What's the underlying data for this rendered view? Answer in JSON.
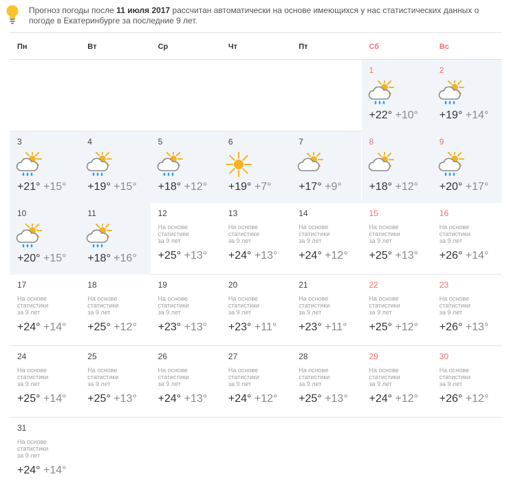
{
  "notice": {
    "text_before": "Прогноз погоды после ",
    "date_bold": "11 июля 2017",
    "text_after": " рассчитан автоматически на основе имеющихся у нас статистических данных о погоде в Екатеринбурге за последние 9 лет."
  },
  "weekdays": [
    "Пн",
    "Вт",
    "Ср",
    "Чт",
    "Пт",
    "Сб",
    "Вс"
  ],
  "stat_label_1": "На основе статистики",
  "stat_label_2": "за 9 лет",
  "colors": {
    "weekend": "#f07070",
    "past_bg": "#f1f5f9",
    "sun": "#f5b324",
    "rain": "#3ba0e0"
  },
  "weeks": [
    [
      null,
      null,
      null,
      null,
      null,
      {
        "day": "1",
        "max": "+22°",
        "min": "+10°",
        "icon": "cloud-sun-rain-icon",
        "past": true
      },
      {
        "day": "2",
        "max": "+19°",
        "min": "+14°",
        "icon": "cloud-sun-rain-icon",
        "past": true
      }
    ],
    [
      {
        "day": "3",
        "max": "+21°",
        "min": "+15°",
        "icon": "cloud-sun-rain-icon",
        "past": true
      },
      {
        "day": "4",
        "max": "+19°",
        "min": "+15°",
        "icon": "cloud-sun-rain-icon",
        "past": true
      },
      {
        "day": "5",
        "max": "+18°",
        "min": "+12°",
        "icon": "cloud-sun-rain-icon",
        "past": true
      },
      {
        "day": "6",
        "max": "+19°",
        "min": "+7°",
        "icon": "sun-icon",
        "past": true
      },
      {
        "day": "7",
        "max": "+17°",
        "min": "+9°",
        "icon": "cloud-sun-icon",
        "past": true
      },
      {
        "day": "8",
        "max": "+18°",
        "min": "+12°",
        "icon": "cloud-sun-icon",
        "past": true
      },
      {
        "day": "9",
        "max": "+20°",
        "min": "+17°",
        "icon": "cloud-sun-rain-icon",
        "past": true
      }
    ],
    [
      {
        "day": "10",
        "max": "+20°",
        "min": "+15°",
        "icon": "cloud-sun-rain-icon",
        "past": true
      },
      {
        "day": "11",
        "max": "+18°",
        "min": "+16°",
        "icon": "cloud-sun-rain-icon",
        "past": true
      },
      {
        "day": "12",
        "max": "+25°",
        "min": "+13°",
        "stat": true
      },
      {
        "day": "13",
        "max": "+24°",
        "min": "+13°",
        "stat": true
      },
      {
        "day": "14",
        "max": "+24°",
        "min": "+12°",
        "stat": true
      },
      {
        "day": "15",
        "max": "+25°",
        "min": "+13°",
        "stat": true
      },
      {
        "day": "16",
        "max": "+26°",
        "min": "+14°",
        "stat": true
      }
    ],
    [
      {
        "day": "17",
        "max": "+24°",
        "min": "+14°",
        "stat": true
      },
      {
        "day": "18",
        "max": "+25°",
        "min": "+12°",
        "stat": true
      },
      {
        "day": "19",
        "max": "+23°",
        "min": "+13°",
        "stat": true
      },
      {
        "day": "20",
        "max": "+23°",
        "min": "+11°",
        "stat": true
      },
      {
        "day": "21",
        "max": "+23°",
        "min": "+11°",
        "stat": true
      },
      {
        "day": "22",
        "max": "+25°",
        "min": "+12°",
        "stat": true
      },
      {
        "day": "23",
        "max": "+26°",
        "min": "+13°",
        "stat": true
      }
    ],
    [
      {
        "day": "24",
        "max": "+25°",
        "min": "+14°",
        "stat": true
      },
      {
        "day": "25",
        "max": "+25°",
        "min": "+13°",
        "stat": true
      },
      {
        "day": "26",
        "max": "+24°",
        "min": "+13°",
        "stat": true
      },
      {
        "day": "27",
        "max": "+24°",
        "min": "+12°",
        "stat": true
      },
      {
        "day": "28",
        "max": "+25°",
        "min": "+13°",
        "stat": true
      },
      {
        "day": "29",
        "max": "+24°",
        "min": "+12°",
        "stat": true
      },
      {
        "day": "30",
        "max": "+26°",
        "min": "+12°",
        "stat": true
      }
    ],
    [
      {
        "day": "31",
        "max": "+24°",
        "min": "+14°",
        "stat": true
      },
      null,
      null,
      null,
      null,
      null,
      null
    ]
  ]
}
